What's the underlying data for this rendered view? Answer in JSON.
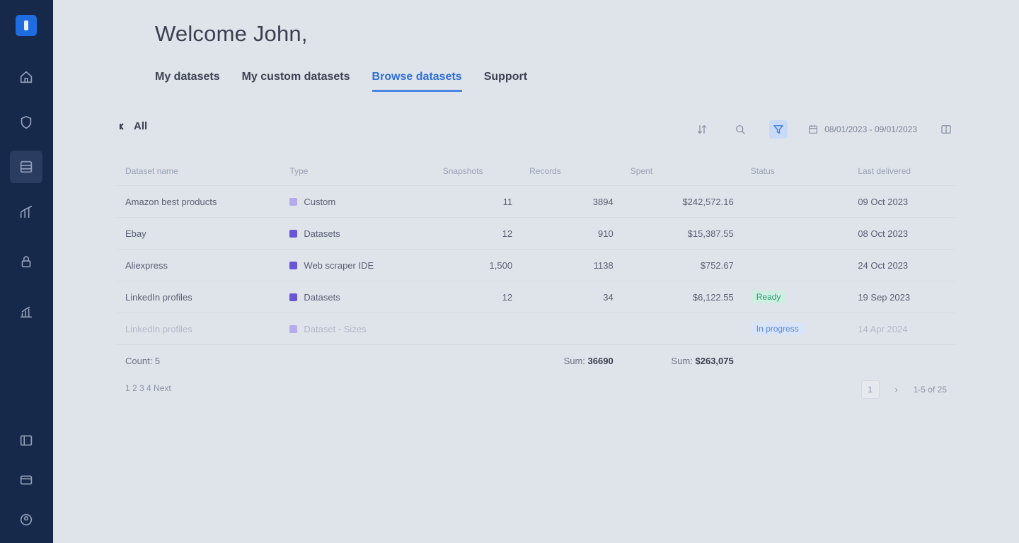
{
  "header": {
    "welcome": "Welcome John,"
  },
  "tabs": [
    {
      "label": "My datasets"
    },
    {
      "label": "My custom datasets"
    },
    {
      "label": "Browse datasets"
    },
    {
      "label": "Support"
    }
  ],
  "toolbar": {
    "filter_label": "All",
    "date_range": "08/01/2023 - 09/01/2023"
  },
  "table": {
    "columns": [
      "Dataset name",
      "Type",
      "Snapshots",
      "Records",
      "Spent",
      "Status",
      "Last delivered"
    ],
    "rows": [
      {
        "name": "Amazon best products",
        "type": "Custom",
        "snapshots": "11",
        "records": "3894",
        "spent": "$242,572.16",
        "status": "",
        "last": "09 Oct 2023"
      },
      {
        "name": "Ebay",
        "type": "Datasets",
        "snapshots": "12",
        "records": "910",
        "spent": "$15,387.55",
        "status": "",
        "last": "08 Oct 2023"
      },
      {
        "name": "Aliexpress",
        "type": "Web scraper IDE",
        "snapshots": "1,500",
        "records": "1138",
        "spent": "$752.67",
        "status": "",
        "last": "24 Oct 2023"
      },
      {
        "name": "LinkedIn profiles",
        "type": "Datasets",
        "snapshots": "12",
        "records": "34",
        "spent": "$6,122.55",
        "status": "Ready",
        "last": "19 Sep 2023"
      },
      {
        "name": "LinkedIn profiles",
        "type": "Dataset - Sizes",
        "snapshots": "",
        "records": "",
        "spent": "",
        "status": "In progress",
        "last": "14 Apr 2024"
      }
    ],
    "totals": {
      "count_label": "Count: 5",
      "records_prefix": "Sum:",
      "records_value": "36690",
      "spent_prefix": "Sum:",
      "spent_value": "$263,075"
    }
  },
  "pagination": {
    "pages_text": "1 2 3 4 Next",
    "current_page": "1",
    "per_page": "1-5 of 25"
  }
}
